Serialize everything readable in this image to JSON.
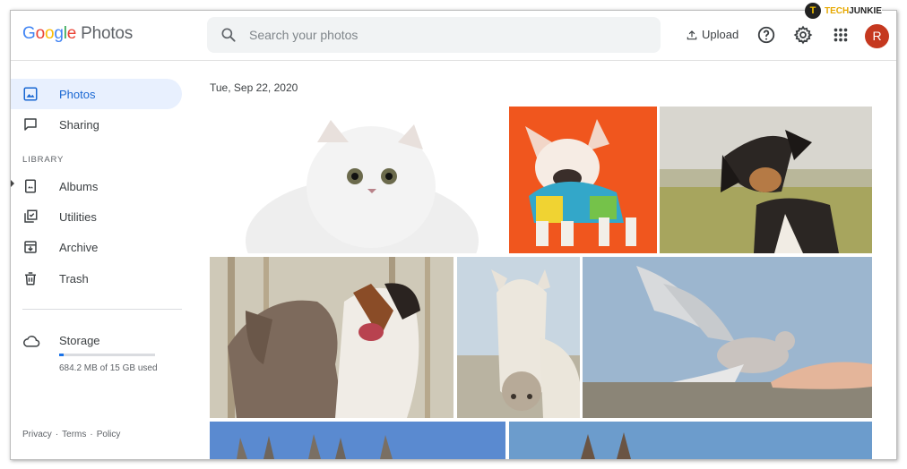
{
  "watermark": {
    "mark": "T",
    "brand_a": "TECH",
    "brand_b": "JUNKIE"
  },
  "header": {
    "logo_letters": [
      "G",
      "o",
      "o",
      "g",
      "l",
      "e"
    ],
    "product": "Photos",
    "search_placeholder": "Search your photos",
    "upload_label": "Upload",
    "avatar_initial": "R"
  },
  "sidebar": {
    "items": [
      {
        "label": "Photos",
        "icon": "photo-icon",
        "active": true
      },
      {
        "label": "Sharing",
        "icon": "chat-icon"
      }
    ],
    "library_heading": "LIBRARY",
    "library_items": [
      {
        "label": "Albums",
        "icon": "album-icon"
      },
      {
        "label": "Utilities",
        "icon": "utilities-icon"
      },
      {
        "label": "Archive",
        "icon": "archive-icon"
      },
      {
        "label": "Trash",
        "icon": "trash-icon"
      }
    ],
    "storage": {
      "label": "Storage",
      "used_text": "684.2 MB of 15 GB used",
      "used_fraction": 0.045
    },
    "footer": {
      "privacy": "Privacy",
      "terms": "Terms",
      "policy": "Policy",
      "separator": "·"
    }
  },
  "main": {
    "date": "Tue, Sep 22, 2020",
    "photos": [
      {
        "subject": "white persian cat"
      },
      {
        "subject": "french bulldog in colorful hoodie on orange"
      },
      {
        "subject": "black and tan dog tilting head in field"
      },
      {
        "subject": "brown dog and australian shepherd"
      },
      {
        "subject": "white horse"
      },
      {
        "subject": "dove landing on hand"
      },
      {
        "subject": "donkeys under blue sky"
      },
      {
        "subject": "giraffe under blue sky"
      }
    ]
  },
  "colors": {
    "accent": "#1a73e8",
    "active_bg": "#e8f0fe",
    "avatar": "#c5381f",
    "search_bg": "#f1f3f4"
  }
}
